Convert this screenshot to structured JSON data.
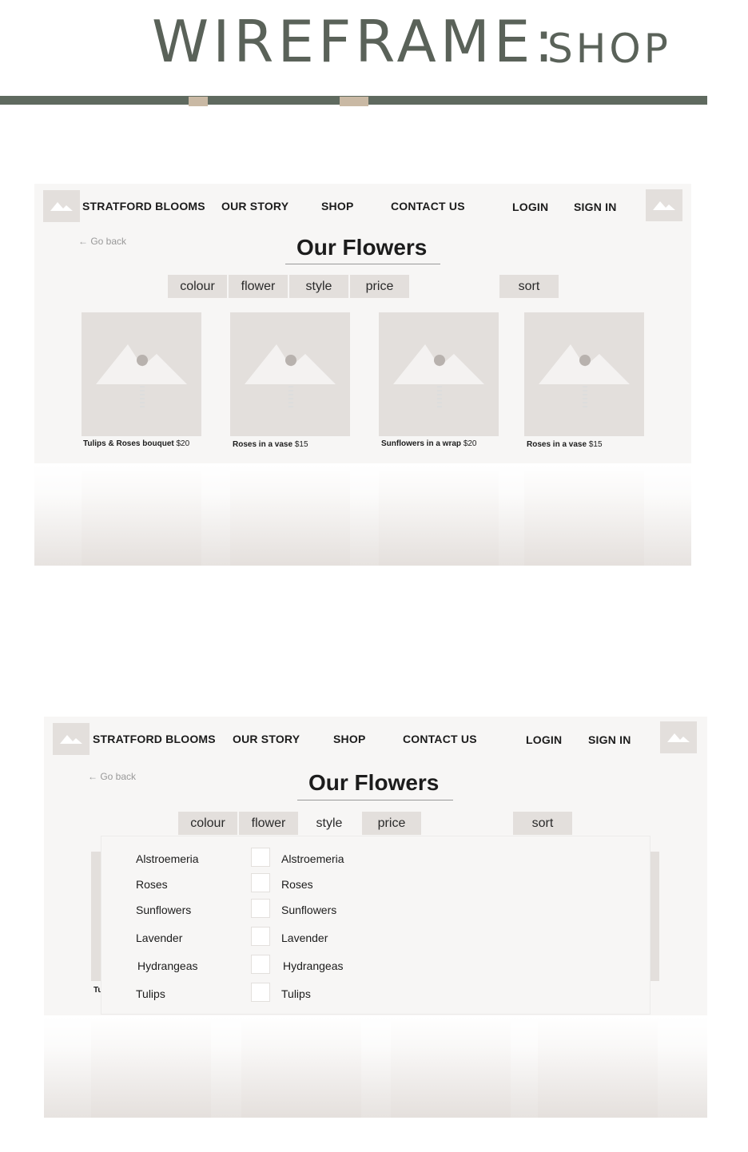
{
  "header": {
    "title": "WIREFRAME:",
    "subtitle": "SHOP"
  },
  "nav": {
    "brand": "STRATFORD BLOOMS",
    "our_story": "OUR STORY",
    "shop": "SHOP",
    "contact": "CONTACT US",
    "login": "LOGIN",
    "signin": "SIGN IN"
  },
  "go_back": "← Go back",
  "page_title": "Our Flowers",
  "filters": {
    "colour": "colour",
    "flower": "flower",
    "style": "style",
    "price": "price",
    "sort": "sort"
  },
  "products": [
    {
      "name": "Tulips & Roses bouquet",
      "price": "$20"
    },
    {
      "name": "Roses in a vase",
      "price": "$15"
    },
    {
      "name": "Sunflowers in a wrap",
      "price": "$20"
    },
    {
      "name": "Roses in a vase",
      "price": "$15"
    }
  ],
  "hidden_caption_fragment": "Tu",
  "dropdown": {
    "options": [
      "Alstroemeria",
      "Roses",
      "Sunflowers",
      "Lavender",
      "Hydrangeas",
      "Tulips"
    ]
  },
  "colors": {
    "accent": "#5f6a5f",
    "placeholder": "#e3dfdc"
  },
  "icons": {
    "image_placeholder": "mountain-image-icon",
    "back": "arrow-left-icon"
  }
}
